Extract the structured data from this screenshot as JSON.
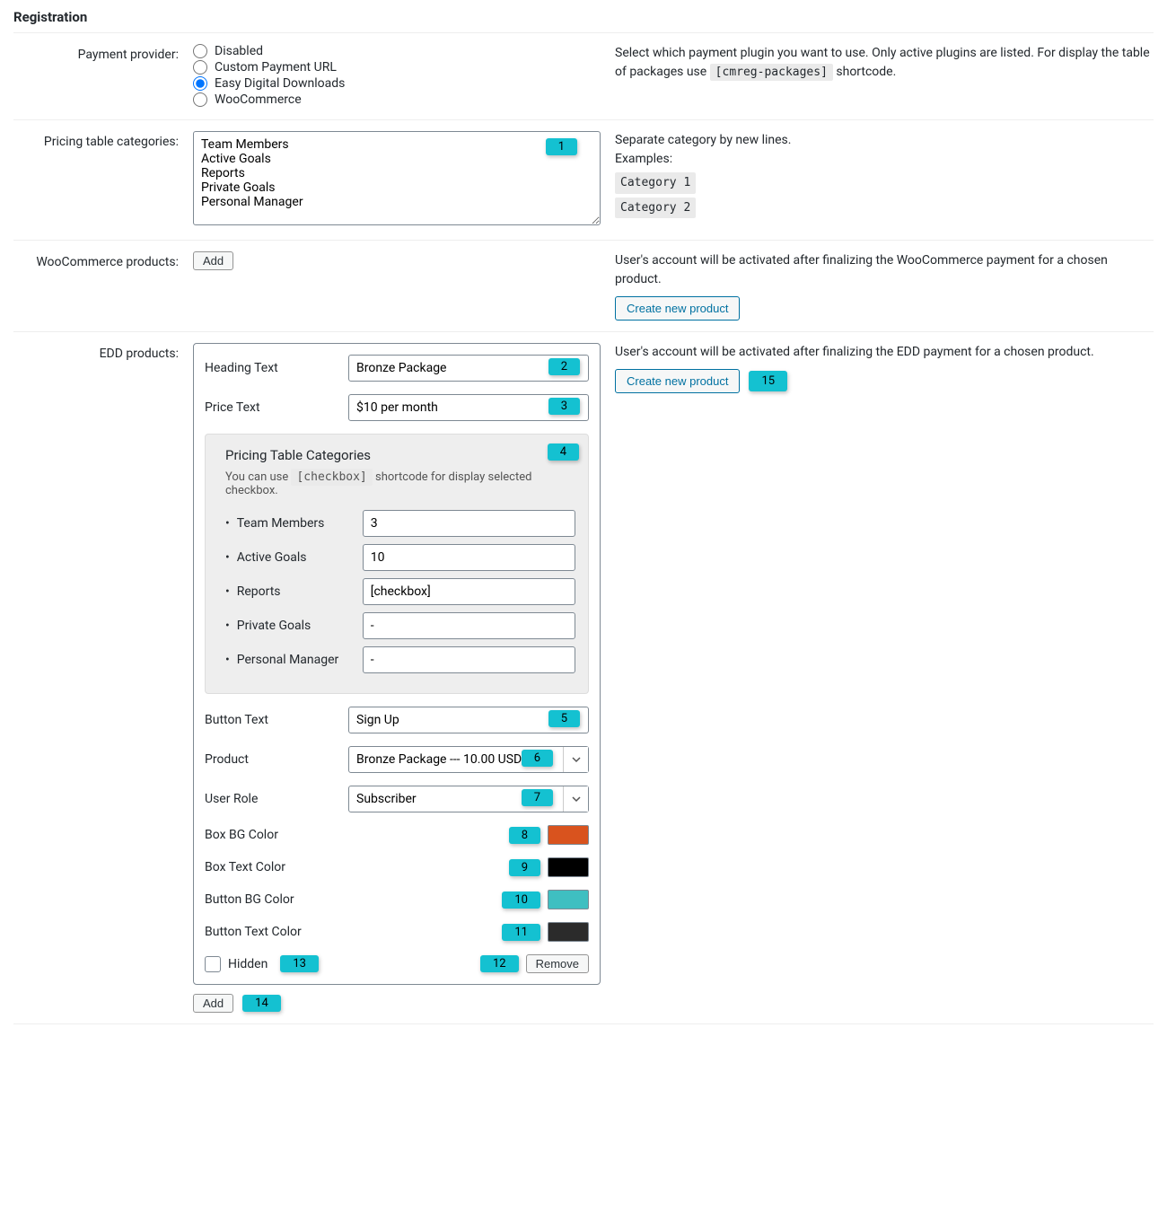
{
  "section_title": "Registration",
  "payment_provider": {
    "label": "Payment provider:",
    "options": [
      "Disabled",
      "Custom Payment URL",
      "Easy Digital Downloads",
      "WooCommerce"
    ],
    "selected_index": 2,
    "desc_prefix": "Select which payment plugin you want to use. Only active plugins are listed. For display the table of packages use ",
    "shortcode": "[cmreg-packages]",
    "desc_suffix": " shortcode."
  },
  "pricing_categories": {
    "label": "Pricing table categories:",
    "value": "Team Members\nActive Goals\nReports\nPrivate Goals\nPersonal Manager",
    "desc_line1": "Separate category by new lines.",
    "desc_line2": "Examples:",
    "example1": "Category 1",
    "example2": "Category 2"
  },
  "woocommerce": {
    "label": "WooCommerce products:",
    "add_button": "Add",
    "desc": "User's account will be activated after finalizing the WooCommerce payment for a chosen product.",
    "create_button": "Create new product"
  },
  "edd": {
    "label": "EDD products:",
    "desc": "User's account will be activated after finalizing the EDD payment for a chosen product.",
    "create_button": "Create new product",
    "add_button": "Add",
    "heading_text_label": "Heading Text",
    "heading_text_value": "Bronze Package",
    "price_text_label": "Price Text",
    "price_text_value": "$10 per month",
    "categories_title": "Pricing Table Categories",
    "categories_hint_prefix": "You can use ",
    "categories_hint_code": "[checkbox]",
    "categories_hint_suffix": " shortcode for display selected checkbox.",
    "categories": [
      {
        "name": "Team Members",
        "value": "3"
      },
      {
        "name": "Active Goals",
        "value": "10"
      },
      {
        "name": "Reports",
        "value": "[checkbox]"
      },
      {
        "name": "Private Goals",
        "value": "-"
      },
      {
        "name": "Personal Manager",
        "value": "-"
      }
    ],
    "button_text_label": "Button Text",
    "button_text_value": "Sign Up",
    "product_label": "Product",
    "product_value": "Bronze Package --- 10.00 USD",
    "user_role_label": "User Role",
    "user_role_value": "Subscriber",
    "box_bg_color_label": "Box BG Color",
    "box_bg_color": "#d9531e",
    "box_text_color_label": "Box Text Color",
    "box_text_color": "#000000",
    "button_bg_color_label": "Button BG Color",
    "button_bg_color": "#3fbfc1",
    "button_text_color_label": "Button Text Color",
    "button_text_color": "#2b2b2b",
    "hidden_label": "Hidden",
    "remove_button": "Remove"
  },
  "badges": {
    "b1": "1",
    "b2": "2",
    "b3": "3",
    "b4": "4",
    "b5": "5",
    "b6": "6",
    "b7": "7",
    "b8": "8",
    "b9": "9",
    "b10": "10",
    "b11": "11",
    "b12": "12",
    "b13": "13",
    "b14": "14",
    "b15": "15"
  }
}
